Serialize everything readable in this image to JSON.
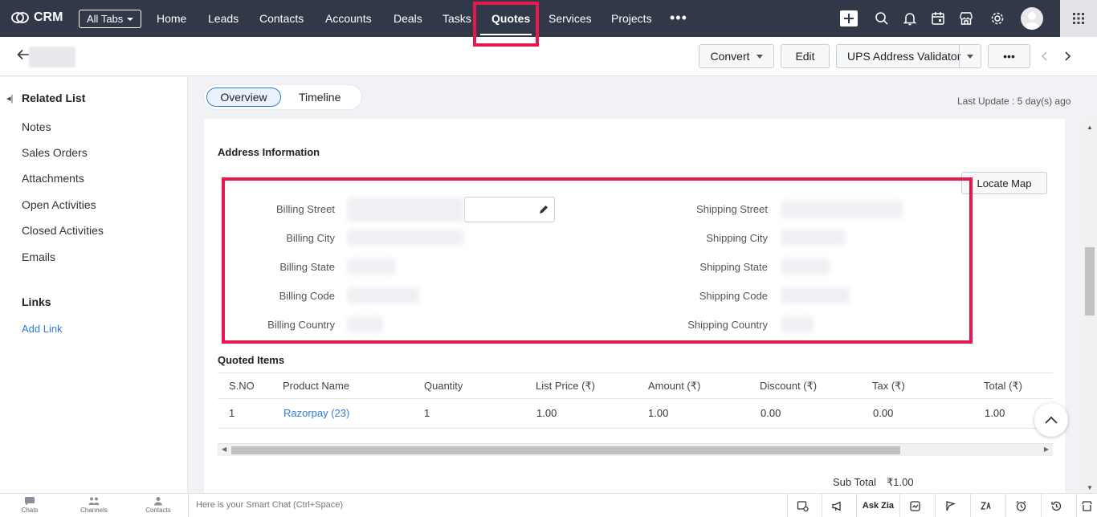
{
  "app": {
    "name": "CRM"
  },
  "topnav": {
    "all_tabs_label": "All Tabs",
    "tabs": [
      {
        "label": "Home"
      },
      {
        "label": "Leads"
      },
      {
        "label": "Contacts"
      },
      {
        "label": "Accounts"
      },
      {
        "label": "Deals"
      },
      {
        "label": "Tasks"
      },
      {
        "label": "Quotes",
        "active": true
      },
      {
        "label": "Services"
      },
      {
        "label": "Projects"
      }
    ],
    "more_label": "•••",
    "icons": [
      "plus-icon",
      "search-icon",
      "bell-icon",
      "calendar-icon",
      "marketplace-icon",
      "gear-icon",
      "avatar",
      "apps-grid-icon"
    ],
    "highlight_color": "#e8184f"
  },
  "record_bar": {
    "convert_label": "Convert",
    "edit_label": "Edit",
    "ups_label": "UPS Address Validator",
    "more_label": "•••"
  },
  "sidebar": {
    "related_list_title": "Related List",
    "items": [
      {
        "label": "Notes"
      },
      {
        "label": "Sales Orders"
      },
      {
        "label": "Attachments"
      },
      {
        "label": "Open Activities"
      },
      {
        "label": "Closed Activities"
      },
      {
        "label": "Emails"
      }
    ],
    "links_title": "Links",
    "add_link_label": "Add Link"
  },
  "main": {
    "tabs": {
      "overview": "Overview",
      "timeline": "Timeline"
    },
    "last_update": "Last Update : 5 day(s) ago",
    "address_section": {
      "title": "Address Information",
      "locate_map_label": "Locate Map",
      "billing_fields": [
        "Billing Street",
        "Billing City",
        "Billing State",
        "Billing Code",
        "Billing Country"
      ],
      "shipping_fields": [
        "Shipping Street",
        "Shipping City",
        "Shipping State",
        "Shipping Code",
        "Shipping Country"
      ]
    },
    "quoted_items": {
      "title": "Quoted Items",
      "columns": [
        "S.NO",
        "Product Name",
        "Quantity",
        "List Price (₹)",
        "Amount (₹)",
        "Discount (₹)",
        "Tax (₹)",
        "Total (₹)"
      ],
      "rows": [
        [
          "1",
          "Razorpay (23)",
          "1",
          "1.00",
          "1.00",
          "0.00",
          "0.00",
          "1.00"
        ]
      ]
    },
    "sub_total": {
      "label": "Sub Total",
      "value": "₹1.00"
    }
  },
  "bottombar": {
    "chats_label": "Chats",
    "channels_label": "Channels",
    "contacts_label": "Contacts",
    "smart_chat_placeholder": "Here is your Smart Chat (Ctrl+Space)",
    "ask_zia_label": "Ask Zia"
  }
}
